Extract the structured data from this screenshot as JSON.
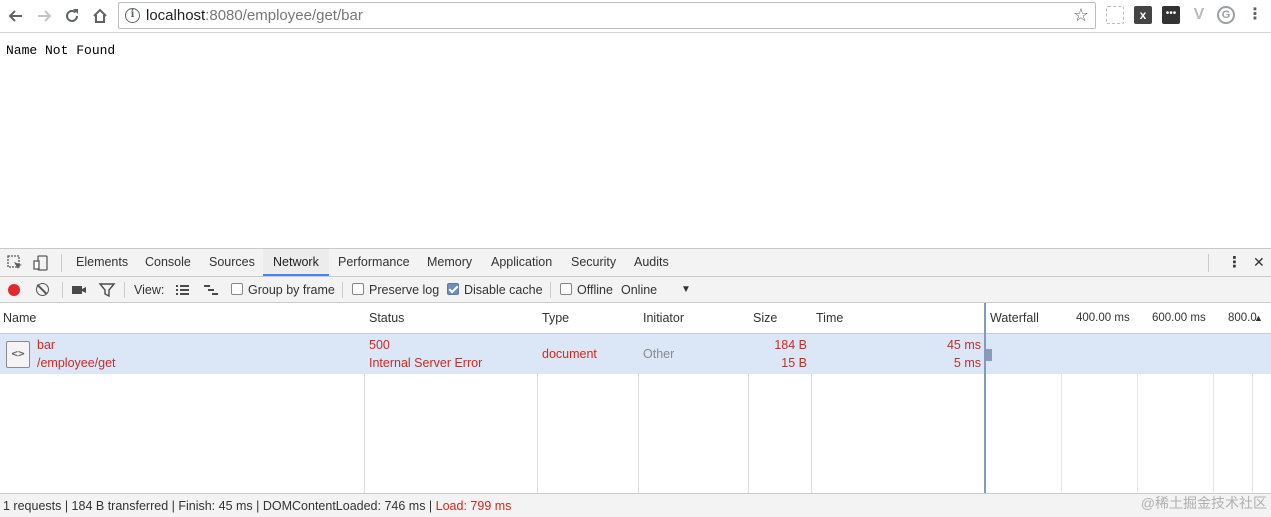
{
  "browser": {
    "url_host": "localhost",
    "url_rest": ":8080/employee/get/bar",
    "info_symbol": "i",
    "back_icon": "arrow-left-icon",
    "forward_icon": "arrow-right-icon",
    "reload_icon": "reload-icon",
    "home_icon": "home-icon",
    "bookmark_icon": "star-icon",
    "extensions": [
      "x",
      "•••",
      "V",
      "G",
      "⋮"
    ]
  },
  "page": {
    "text": "Name Not Found"
  },
  "devtools": {
    "tabs": [
      "Elements",
      "Console",
      "Sources",
      "Network",
      "Performance",
      "Memory",
      "Application",
      "Security",
      "Audits"
    ],
    "active_tab": "Network",
    "menu_symbol": "⋮",
    "close_symbol": "✕",
    "toolbar": {
      "view_label": "View:",
      "group_by_frame": "Group by frame",
      "group_by_frame_checked": false,
      "preserve_log": "Preserve log",
      "preserve_log_checked": false,
      "disable_cache": "Disable cache",
      "disable_cache_checked": true,
      "offline": "Offline",
      "offline_checked": false,
      "throttling": "Online",
      "throttling_arrow": "▼"
    },
    "columns": {
      "name": "Name",
      "status": "Status",
      "type": "Type",
      "initiator": "Initiator",
      "size": "Size",
      "time": "Time",
      "waterfall": "Waterfall",
      "t400": "400.00 ms",
      "t600": "600.00 ms",
      "t800": "800.0",
      "sort_arrow": "▲"
    },
    "rows": [
      {
        "name": "bar",
        "path": "/employee/get",
        "status_code": "500",
        "status_text": "Internal Server Error",
        "type": "document",
        "initiator": "Other",
        "size": "184 B",
        "content_size": "15 B",
        "time": "45 ms",
        "latency": "5 ms",
        "icon_glyph": "<>"
      }
    ],
    "summary": {
      "main": "1 requests | 184 B transferred | Finish: 45 ms | DOMContentLoaded: 746 ms | ",
      "load": "Load: 799 ms"
    }
  },
  "watermark": "@稀土掘金技术社区",
  "colors": {
    "error": "#d4281f",
    "record": "#e0282e",
    "selected_row": "#dbe7f7"
  }
}
